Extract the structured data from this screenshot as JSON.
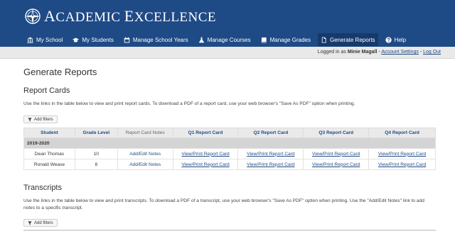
{
  "brand": {
    "cap1": "A",
    "rest1": "CADEMIC ",
    "cap2": "E",
    "rest2": "XCELLENCE",
    "logo_icon": "compass-rose-icon"
  },
  "nav": [
    {
      "label": "My School",
      "icon": "school-building-icon"
    },
    {
      "label": "My Students",
      "icon": "graduation-cap-icon"
    },
    {
      "label": "Manage School Years",
      "icon": "calendar-icon"
    },
    {
      "label": "Manage Courses",
      "icon": "flask-icon"
    },
    {
      "label": "Manage Grades",
      "icon": "book-icon"
    },
    {
      "label": "Generate Reports",
      "icon": "document-icon",
      "active": true
    },
    {
      "label": "Help",
      "icon": "question-circle-icon"
    }
  ],
  "userbar": {
    "prefix": "Logged in as ",
    "name": "Minie Magall",
    "sep1": " - ",
    "account_settings": "Account Settings",
    "sep2": " - ",
    "logout": "Log Out"
  },
  "page_title": "Generate Reports",
  "report_cards": {
    "heading": "Report Cards",
    "description": "Use the links in the table below to view and print report cards. To download a PDF of a report card, use your web browser's \"Save As PDF\" option when printing.",
    "filter_label": "Add filters",
    "columns": [
      "Student",
      "Grade Level",
      "Report Card Notes",
      "Q1 Report Card",
      "Q2 Report Card",
      "Q3 Report Card",
      "Q4 Report Card"
    ],
    "group": "2019-2020",
    "rows": [
      {
        "student": "Dean Thomas",
        "grade": "10",
        "notes": "Add/Edit Notes",
        "q1": "View/Print Report Card",
        "q2": "View/Print Report Card",
        "q3": "View/Print Report Card",
        "q4": "View/Print Report Card"
      },
      {
        "student": "Ronald Wease",
        "grade": "8",
        "notes": "Add/Edit Notes",
        "q1": "View/Print Report Card",
        "q2": "View/Print Report Card",
        "q3": "View/Print Report Card",
        "q4": "View/Print Report Card"
      }
    ]
  },
  "transcripts": {
    "heading": "Transcripts",
    "description": "Use the links in the table below to view and print transcripts. To download a PDF of a transcript, use your web browser's \"Save As PDF\" option when printing. Use the \"Add/Edit Notes\" link to add notes to a specific transcript.",
    "filter_label": "Add filters"
  },
  "colors": {
    "brand_blue": "#1e4a86",
    "active_nav": "#163a6c",
    "userbar_bg": "#e9e9e9",
    "group_row_bg": "#d4d4d4"
  }
}
